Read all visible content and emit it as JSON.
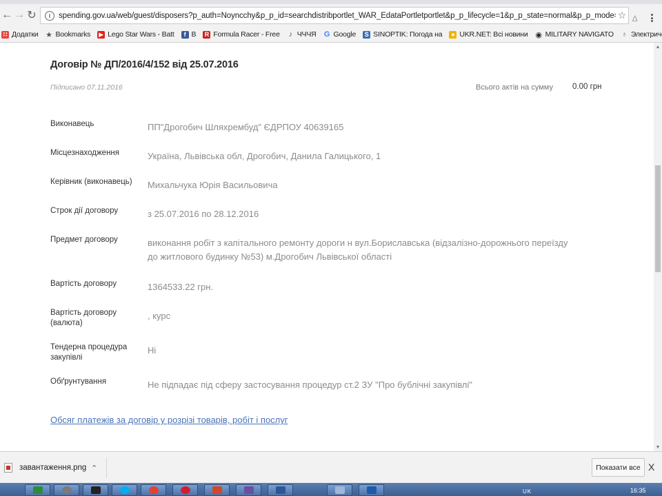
{
  "browser": {
    "url": "spending.gov.ua/web/guest/disposers?p_auth=Noyncchy&p_p_id=searchdistribportlet_WAR_EdataPortletportlet&p_p_lifecycle=1&p_p_state=normal&p_p_mode=view&p_p_col_id=colur",
    "bookmarks": [
      {
        "label": "Додатки",
        "icon": "apps-grid-icon",
        "color": "#e8453c"
      },
      {
        "label": "Bookmarks",
        "icon": "star-icon",
        "color": "#555555"
      },
      {
        "label": "Lego Star Wars - Batt",
        "icon": "youtube-icon",
        "color": "#e62117"
      },
      {
        "label": "B",
        "icon": "facebook-icon",
        "color": "#3b5998"
      },
      {
        "label": "Formula Racer - Free",
        "icon": "racer-icon",
        "color": "#cc2222"
      },
      {
        "label": "ЧЧЧЯ",
        "icon": "game-icon",
        "color": "#2e7d32"
      },
      {
        "label": "Google",
        "icon": "google-icon",
        "color": "#4285f4"
      },
      {
        "label": "SINOPTIK: Погода на",
        "icon": "weather-icon",
        "color": "#3a6fb0"
      },
      {
        "label": "UKR.NET: Всі новини",
        "icon": "ukrnet-icon",
        "color": "#f0b400"
      },
      {
        "label": "MILITARY NAVIGATO",
        "icon": "military-icon",
        "color": "#222222"
      },
      {
        "label": "Электрические",
        "icon": "bulb-icon",
        "color": "#777777"
      }
    ]
  },
  "contract": {
    "title": "Договір № ДП/2016/4/152 від 25.07.2016",
    "signed": "Підписано 07.11.2016",
    "acts_label": "Всього актів на сумму",
    "acts_value": "0.00 грн",
    "fields": [
      {
        "label": "Виконавець",
        "value": "ПП\"Дрогобич Шляхрембуд\" ЄДРПОУ 40639165"
      },
      {
        "label": "Місцезнаходження",
        "value": "Україна, Львівська обл, Дрогобич, Данила Галицького, 1"
      },
      {
        "label": "Керівник (виконавець)",
        "value": "Михальчука Юрія Васильовича"
      },
      {
        "label": "Строк дії договору",
        "value": "з 25.07.2016 по 28.12.2016"
      },
      {
        "label": "Предмет договору",
        "value": "виконання робіт з капітального ремонту дороги н вул.Бориславська (відзалізно-дорожнього переїзду до житлового будинку №53) м.Дрогобич Львівської області"
      },
      {
        "label": "Вартість договору",
        "value": "1364533.22 грн."
      },
      {
        "label": "Вартість договору (валюта)",
        "value": ", курс"
      },
      {
        "label": "Тендерна процедура закупівлі",
        "value": "Ні"
      },
      {
        "label": "Обґрунтування",
        "value": "Не підпадає під сферу застосування процедур ст.2 ЗУ \"Про бублічні закупівлі\""
      }
    ],
    "payments_link": "Обсяг платежів за договір у розрізі товарів, робіт і послуг"
  },
  "downloads": {
    "file_name": "завантаження.png",
    "show_all": "Показати все",
    "close": "X"
  },
  "taskbar": {
    "clock": "16:35",
    "tray": "UK"
  }
}
